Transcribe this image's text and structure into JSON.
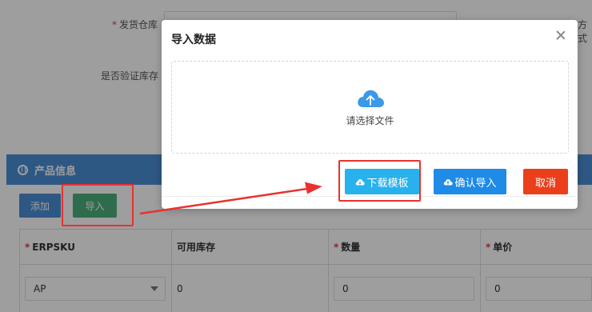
{
  "form": {
    "warehouse_label": "发货仓库",
    "verify_stock_label": "是否验证库存",
    "right_label_partial": "方式"
  },
  "product_section": {
    "title": "产品信息",
    "add_button": "添加",
    "import_button": "导入"
  },
  "table": {
    "headers": [
      {
        "required": true,
        "label": "ERPSKU"
      },
      {
        "required": false,
        "label": "可用库存"
      },
      {
        "required": true,
        "label": "数量"
      },
      {
        "required": true,
        "label": "单价"
      }
    ],
    "row": {
      "erpsku": "AP",
      "available_stock": "0",
      "quantity": "0",
      "unit_price": "0"
    }
  },
  "modal": {
    "title": "导入数据",
    "drop_hint": "请选择文件",
    "download_button": "下载模板",
    "confirm_button": "确认导入",
    "cancel_button": "取消"
  },
  "required_mark": "*",
  "colors": {
    "primary": "#4b8fd6",
    "import_green": "#4caf7d",
    "download_cyan": "#27b2ee",
    "confirm_blue": "#1e8be6",
    "cancel_red": "#eb3f1c",
    "annotation_red": "#e8322f"
  }
}
